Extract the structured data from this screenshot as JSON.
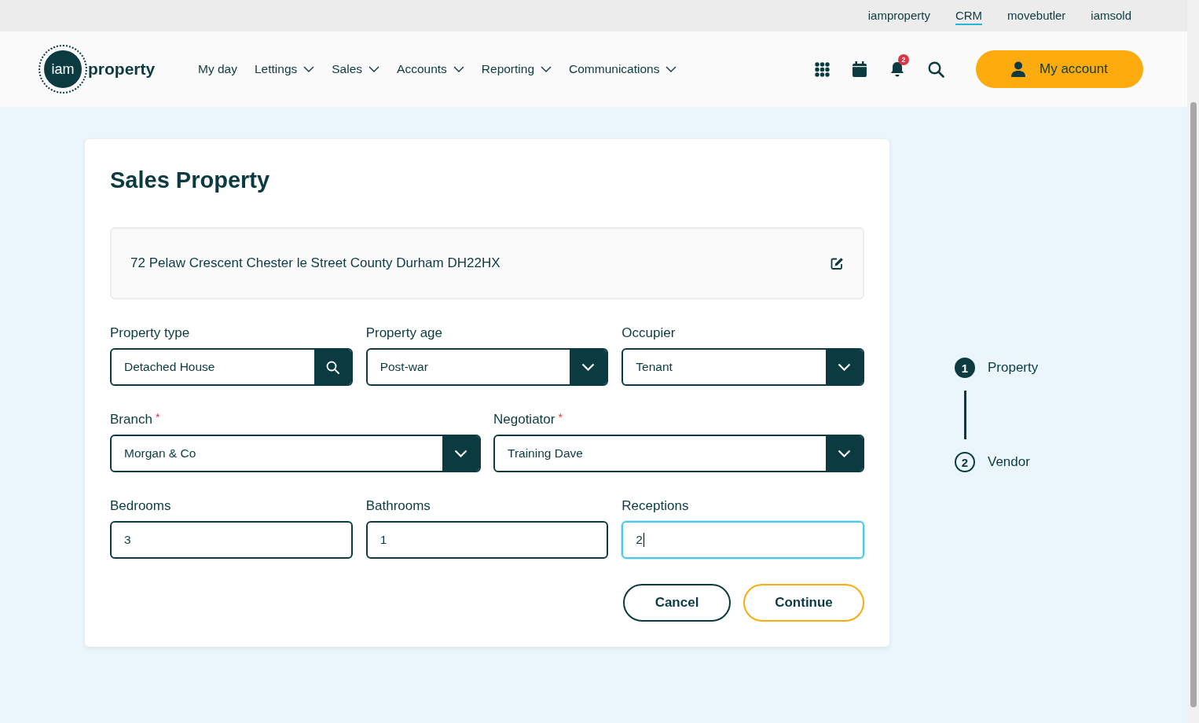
{
  "top_links": [
    {
      "label": "iamproperty",
      "selected": false
    },
    {
      "label": "CRM",
      "selected": true
    },
    {
      "label": "movebutler",
      "selected": false
    },
    {
      "label": "iamsold",
      "selected": false
    }
  ],
  "logo": {
    "mark": "iam",
    "word": "property"
  },
  "nav": [
    {
      "label": "My day",
      "dropdown": false
    },
    {
      "label": "Lettings",
      "dropdown": true
    },
    {
      "label": "Sales",
      "dropdown": true
    },
    {
      "label": "Accounts",
      "dropdown": true
    },
    {
      "label": "Reporting",
      "dropdown": true
    },
    {
      "label": "Communications",
      "dropdown": true
    }
  ],
  "notifications": {
    "count": "2"
  },
  "account_button": "My account",
  "required_mark": "*",
  "card": {
    "title": "Sales Property",
    "address": "72 Pelaw Crescent Chester le Street County Durham DH22HX"
  },
  "field_rows": [
    [
      {
        "label": "Property type",
        "kind": "search",
        "value": "Detached House",
        "required": false,
        "focused": false
      },
      {
        "label": "Property age",
        "kind": "select",
        "value": "Post-war",
        "required": false,
        "focused": false
      },
      {
        "label": "Occupier",
        "kind": "select",
        "value": "Tenant",
        "required": false,
        "focused": false
      }
    ],
    [
      {
        "label": "Branch",
        "kind": "select",
        "value": "Morgan & Co",
        "required": true,
        "focused": false
      },
      {
        "label": "Negotiator",
        "kind": "select",
        "value": "Training Dave",
        "required": true,
        "focused": false
      }
    ],
    [
      {
        "label": "Bedrooms",
        "kind": "text",
        "value": "3",
        "required": false,
        "focused": false
      },
      {
        "label": "Bathrooms",
        "kind": "text",
        "value": "1",
        "required": false,
        "focused": false
      },
      {
        "label": "Receptions",
        "kind": "text",
        "value": "2",
        "required": false,
        "focused": true
      }
    ]
  ],
  "buttons": [
    {
      "label": "Cancel",
      "kind": "secondary"
    },
    {
      "label": "Continue",
      "kind": "primary"
    }
  ],
  "steps": [
    {
      "number": "1",
      "label": "Property",
      "selected": true
    },
    {
      "number": "2",
      "label": "Vendor",
      "selected": false
    }
  ]
}
